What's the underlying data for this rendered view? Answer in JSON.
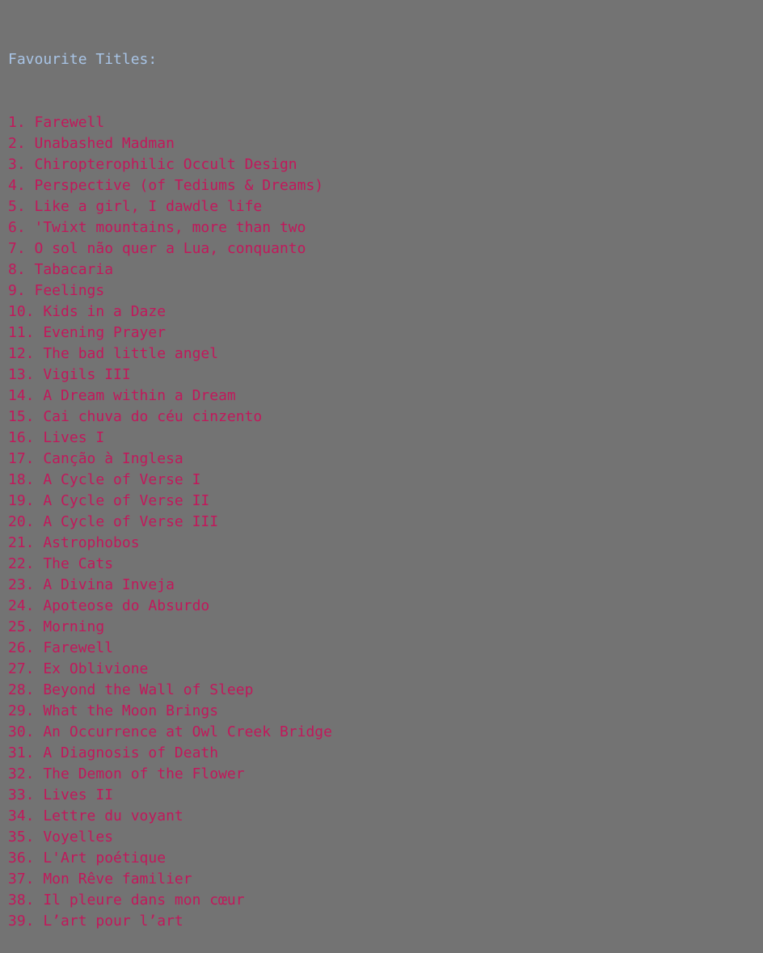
{
  "console": {
    "header": "Favourite Titles:",
    "lines": [
      "1. Farewell",
      "2. Unabashed Madman",
      "3. Chiropterophilic Occult Design",
      "4. Perspective (of Tediums & Dreams)",
      "5. Like a girl, I dawdle life",
      "6. 'Twixt mountains, more than two",
      "7. O sol não quer a Lua, conquanto",
      "8. Tabacaria",
      "9. Feelings",
      "10. Kids in a Daze",
      "11. Evening Prayer",
      "12. The bad little angel",
      "13. Vigils III",
      "14. A Dream within a Dream",
      "15. Cai chuva do céu cinzento",
      "16. Lives I",
      "17. Canção à Inglesa",
      "18. A Cycle of Verse I",
      "19. A Cycle of Verse II",
      "20. A Cycle of Verse III",
      "21. Astrophobos",
      "22. The Cats",
      "23. A Divina Inveja",
      "24. Apoteose do Absurdo",
      "25. Morning",
      "26. Farewell",
      "27. Ex Oblivione",
      "28. Beyond the Wall of Sleep",
      "29. What the Moon Brings",
      "30. An Occurrence at Owl Creek Bridge",
      "31. A Diagnosis of Death",
      "32. The Demon of the Flower",
      "33. Lives II",
      "34. Lettre du voyant",
      "35. Voyelles",
      "36. L'Art poétique",
      "37. Mon Rêve familier",
      "38. Il pleure dans mon cœur",
      "39. L’art pour l’art"
    ]
  },
  "colors": {
    "background": "#737373",
    "header": "#a8c4e6",
    "item": "#c2185b"
  }
}
